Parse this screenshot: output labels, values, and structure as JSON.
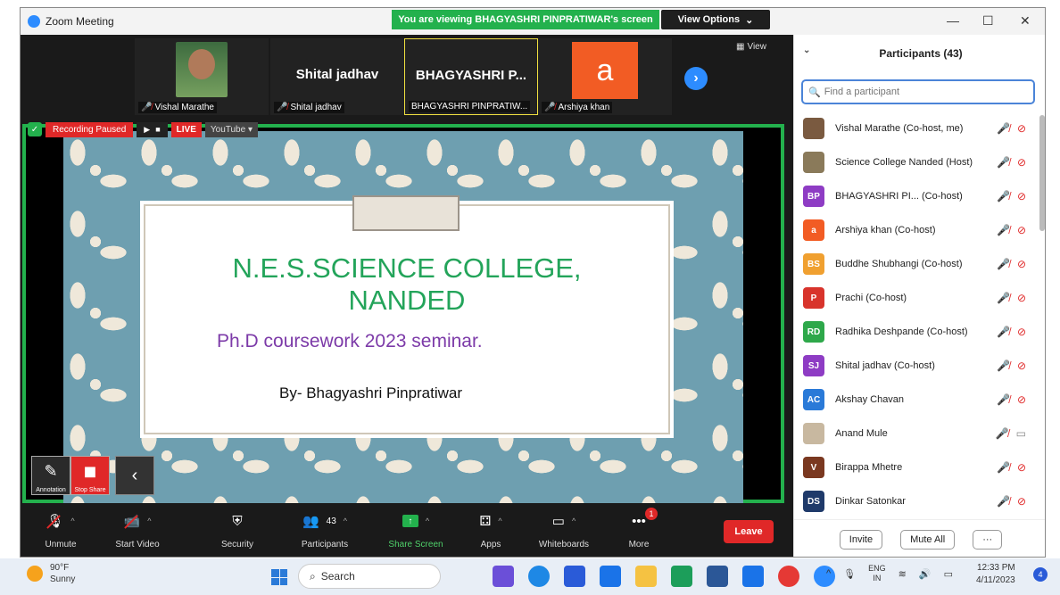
{
  "window": {
    "title": "Zoom Meeting",
    "share_banner": "You are viewing BHAGYASHRI PINPRATIWAR's screen",
    "view_options": "View Options"
  },
  "filmstrip": {
    "tiles": [
      {
        "name": "Vishal Marathe",
        "big": ""
      },
      {
        "name": "Shital jadhav",
        "big": "Shital jadhav"
      },
      {
        "name": "BHAGYASHRI PINPRATIW...",
        "big": "BHAGYASHRI P..."
      },
      {
        "name": "Arshiya khan",
        "big": "",
        "avatar": "a"
      }
    ],
    "view_label": "View"
  },
  "recording": {
    "paused_label": "Recording Paused",
    "live_label": "LIVE",
    "stream_label": "YouTube"
  },
  "slide": {
    "title_line1": "N.E.S.SCIENCE COLLEGE,",
    "title_line2": "NANDED",
    "subtitle": "Ph.D coursework 2023 seminar.",
    "by": "By- Bhagyashri Pinpratiwar"
  },
  "annotation": {
    "annotate_label": "Annotation",
    "stop_share_label": "Stop Share"
  },
  "toolbar": {
    "unmute": "Unmute",
    "start_video": "Start Video",
    "security": "Security",
    "participants": "Participants",
    "participants_count": "43",
    "share_screen": "Share Screen",
    "apps": "Apps",
    "whiteboards": "Whiteboards",
    "more": "More",
    "more_badge": "1",
    "leave": "Leave"
  },
  "panel": {
    "title": "Participants (43)",
    "search_placeholder": "Find a participant",
    "participants": [
      {
        "name": "Vishal Marathe (Co-host, me)",
        "initials": "",
        "color": "#7a5a40",
        "video": "off"
      },
      {
        "name": "Science College Nanded (Host)",
        "initials": "",
        "color": "#8a7a5a",
        "video": "off"
      },
      {
        "name": "BHAGYASHRI PI... (Co-host)",
        "initials": "BP",
        "color": "#8e3cc4",
        "video": "off"
      },
      {
        "name": "Arshiya khan (Co-host)",
        "initials": "a",
        "color": "#f25c24",
        "video": "off"
      },
      {
        "name": "Buddhe Shubhangi (Co-host)",
        "initials": "BS",
        "color": "#f0a030",
        "video": "off"
      },
      {
        "name": "Prachi (Co-host)",
        "initials": "P",
        "color": "#d8342c",
        "video": "off"
      },
      {
        "name": "Radhika Deshpande (Co-host)",
        "initials": "RD",
        "color": "#2ea84a",
        "video": "off"
      },
      {
        "name": "Shital jadhav (Co-host)",
        "initials": "SJ",
        "color": "#8e3cc4",
        "video": "off"
      },
      {
        "name": "Akshay Chavan",
        "initials": "AC",
        "color": "#2a7ad8",
        "video": "off"
      },
      {
        "name": "Anand Mule",
        "initials": "",
        "color": "#c8b8a0",
        "video": "on"
      },
      {
        "name": "Birappa Mhetre",
        "initials": "V",
        "color": "#7a3820",
        "video": "off"
      },
      {
        "name": "Dinkar Satonkar",
        "initials": "DS",
        "color": "#1f3a6a",
        "video": "off"
      }
    ],
    "invite": "Invite",
    "mute_all": "Mute All",
    "more": "···"
  },
  "taskbar": {
    "weather_temp": "90°F",
    "weather_desc": "Sunny",
    "search": "Search",
    "lang_top": "ENG",
    "lang_bottom": "IN",
    "time": "12:33 PM",
    "date": "4/11/2023",
    "notifications": "4"
  }
}
